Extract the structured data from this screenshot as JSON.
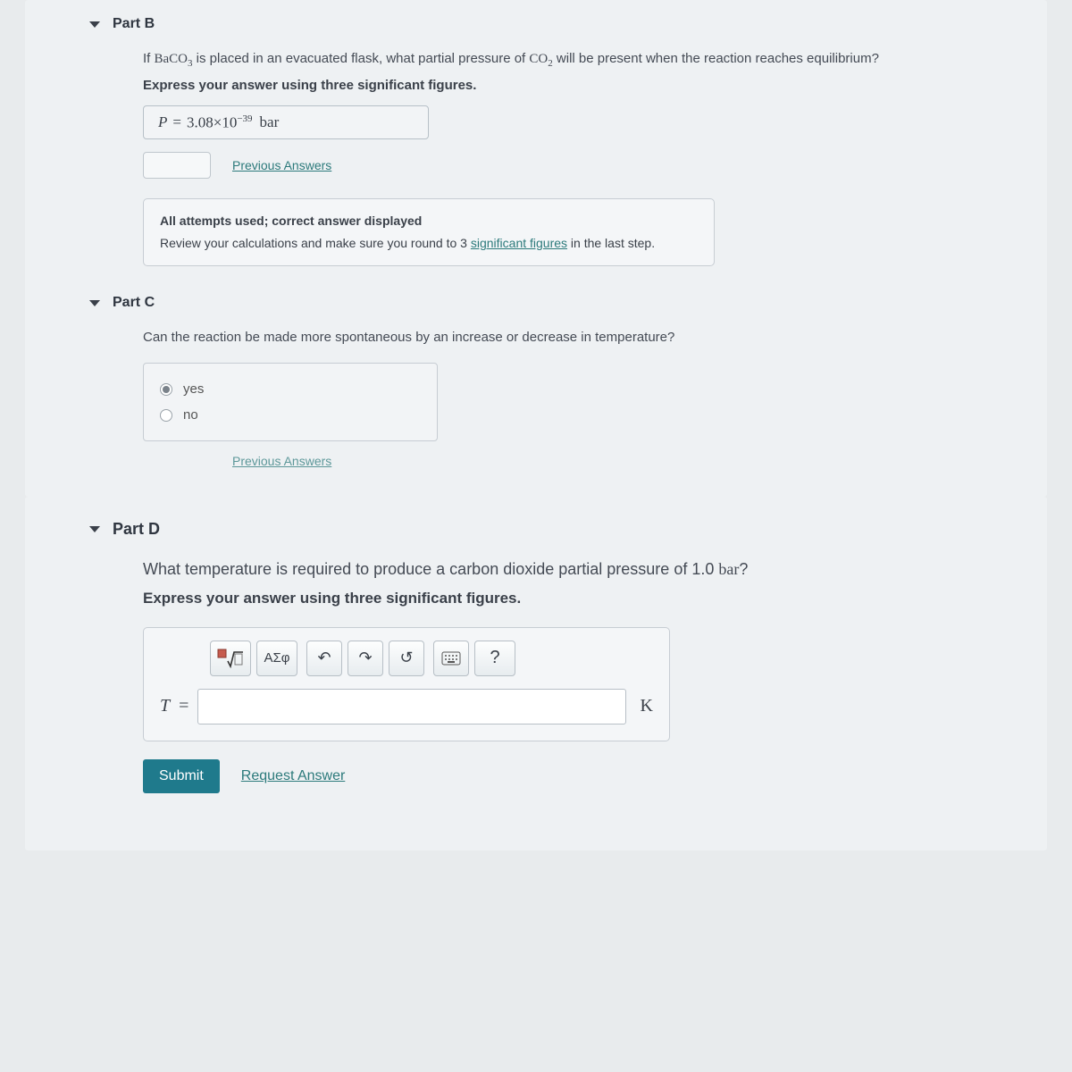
{
  "partB": {
    "title": "Part B",
    "question_pre": "If ",
    "compound": "BaCO",
    "compound_sub": "3",
    "question_mid": " is placed in an evacuated flask, what partial pressure of ",
    "gas": "CO",
    "gas_sub": "2",
    "question_post": " will be present when the reaction reaches equilibrium?",
    "instruction": "Express your answer using three significant figures.",
    "var": "P",
    "eq": "=",
    "val_base": "3.08×10",
    "val_exp": "−39",
    "val_unit": "bar",
    "prev_answers": "Previous Answers",
    "feedback_title": "All attempts used; correct answer displayed",
    "feedback_pre": "Review your calculations and make sure you round to 3 ",
    "feedback_link": "significant figures",
    "feedback_post": " in the last step."
  },
  "partC": {
    "title": "Part C",
    "question": "Can the reaction be made more spontaneous by an increase or decrease in temperature?",
    "opt_yes": "yes",
    "opt_no": "no",
    "prev_answers": "Previous Answers"
  },
  "partD": {
    "title": "Part D",
    "question_pre": "What temperature is required to produce a carbon dioxide partial pressure of 1.0 ",
    "question_unit": "bar",
    "question_post": "?",
    "instruction": "Express your answer using three significant figures.",
    "tb_greek": "ΑΣφ",
    "tb_help": "?",
    "var": "T",
    "eq": "=",
    "unit": "K",
    "submit": "Submit",
    "request": "Request Answer"
  }
}
